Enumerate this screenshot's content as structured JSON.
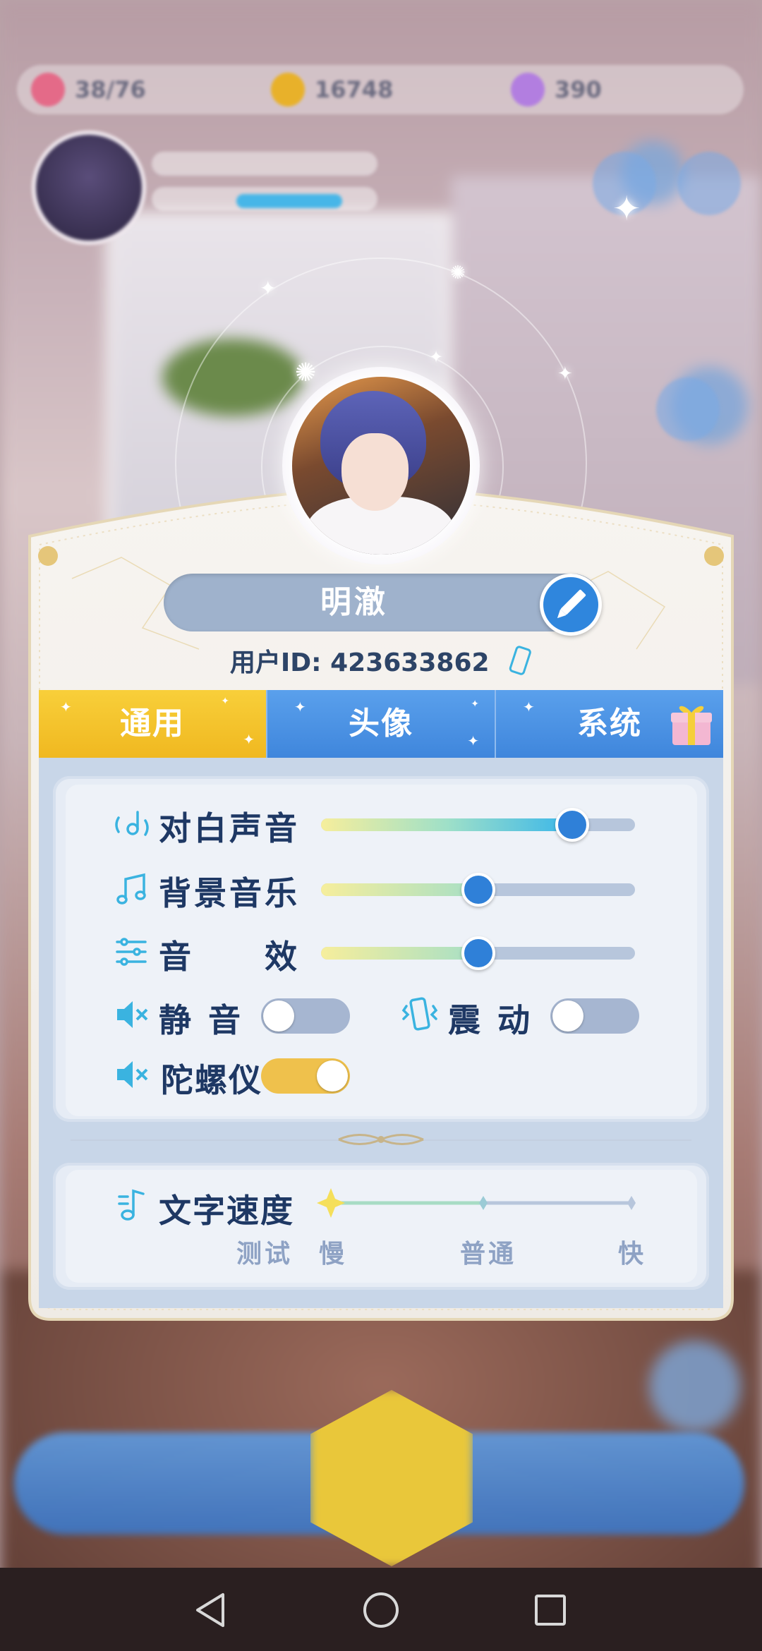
{
  "status_bar": {
    "stamina": "38/76",
    "gold": "16748",
    "diamond": "390"
  },
  "profile": {
    "name": "明澈",
    "user_id_label": "用户ID:",
    "user_id": "423633862"
  },
  "tabs": [
    {
      "label": "通用",
      "active": true
    },
    {
      "label": "头像",
      "active": false
    },
    {
      "label": "系统",
      "active": false
    }
  ],
  "settings": {
    "dialogue_voice": {
      "label": "对白声音",
      "level": 0.8
    },
    "bgm": {
      "label": "背景音乐",
      "level": 0.5
    },
    "sound_effects": {
      "label": "音　　效",
      "level": 0.5
    },
    "mute": {
      "label": "静 音",
      "on": false
    },
    "vibration": {
      "label": "震 动",
      "on": false
    },
    "gyroscope": {
      "label": "陀螺仪",
      "on": true
    }
  },
  "text_speed": {
    "label": "文字速度",
    "test_label": "测试",
    "options": [
      "慢",
      "普通",
      "快"
    ],
    "selected": "慢"
  },
  "colors": {
    "accent_blue": "#2f80d8",
    "tab_active": "#f2bc22",
    "label_text": "#1e3864",
    "icon_cyan": "#3ab3e0"
  },
  "navbar": {
    "icons": [
      "back-icon",
      "home-icon",
      "recents-icon"
    ]
  }
}
